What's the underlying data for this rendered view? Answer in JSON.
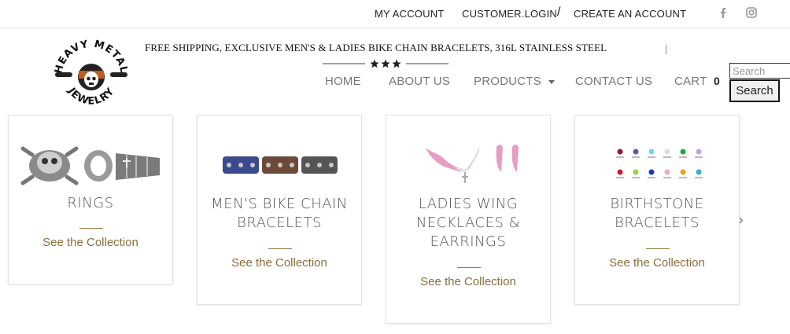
{
  "topbar": {
    "my_account": "MY ACCOUNT",
    "customer_login": "CUSTOMER.LOGIN",
    "separator": "/",
    "create_account": "CREATE AN ACCOUNT"
  },
  "logo": {
    "text_top": "HEAVY METAL",
    "text_bottom": "JEWELRY"
  },
  "tagline": "FREE SHIPPING, EXCLUSIVE MEN'S & LADIES BIKE CHAIN BRACELETS, 316L STAINLESS STEEL",
  "nav": {
    "home": "HOME",
    "about": "ABOUT US",
    "products": "PRODUCTS",
    "contact": "CONTACT US",
    "cart": "CART",
    "cart_count": "0"
  },
  "search": {
    "placeholder": "Search",
    "button": "Search"
  },
  "carousel": {
    "cards": [
      {
        "title": "RINGS",
        "link": "See the Collection"
      },
      {
        "title": "MEN'S BIKE CHAIN BRACELETS",
        "link": "See the Collection"
      },
      {
        "title": "LADIES WING NECKLACES & EARRINGS",
        "link": "See the Collection"
      },
      {
        "title": "BIRTHSTONE BRACELETS",
        "link": "See the Collection"
      }
    ],
    "prev": "‹",
    "next": "›"
  },
  "colors": {
    "accent": "#8a6d3b",
    "nav_text": "#777777"
  }
}
